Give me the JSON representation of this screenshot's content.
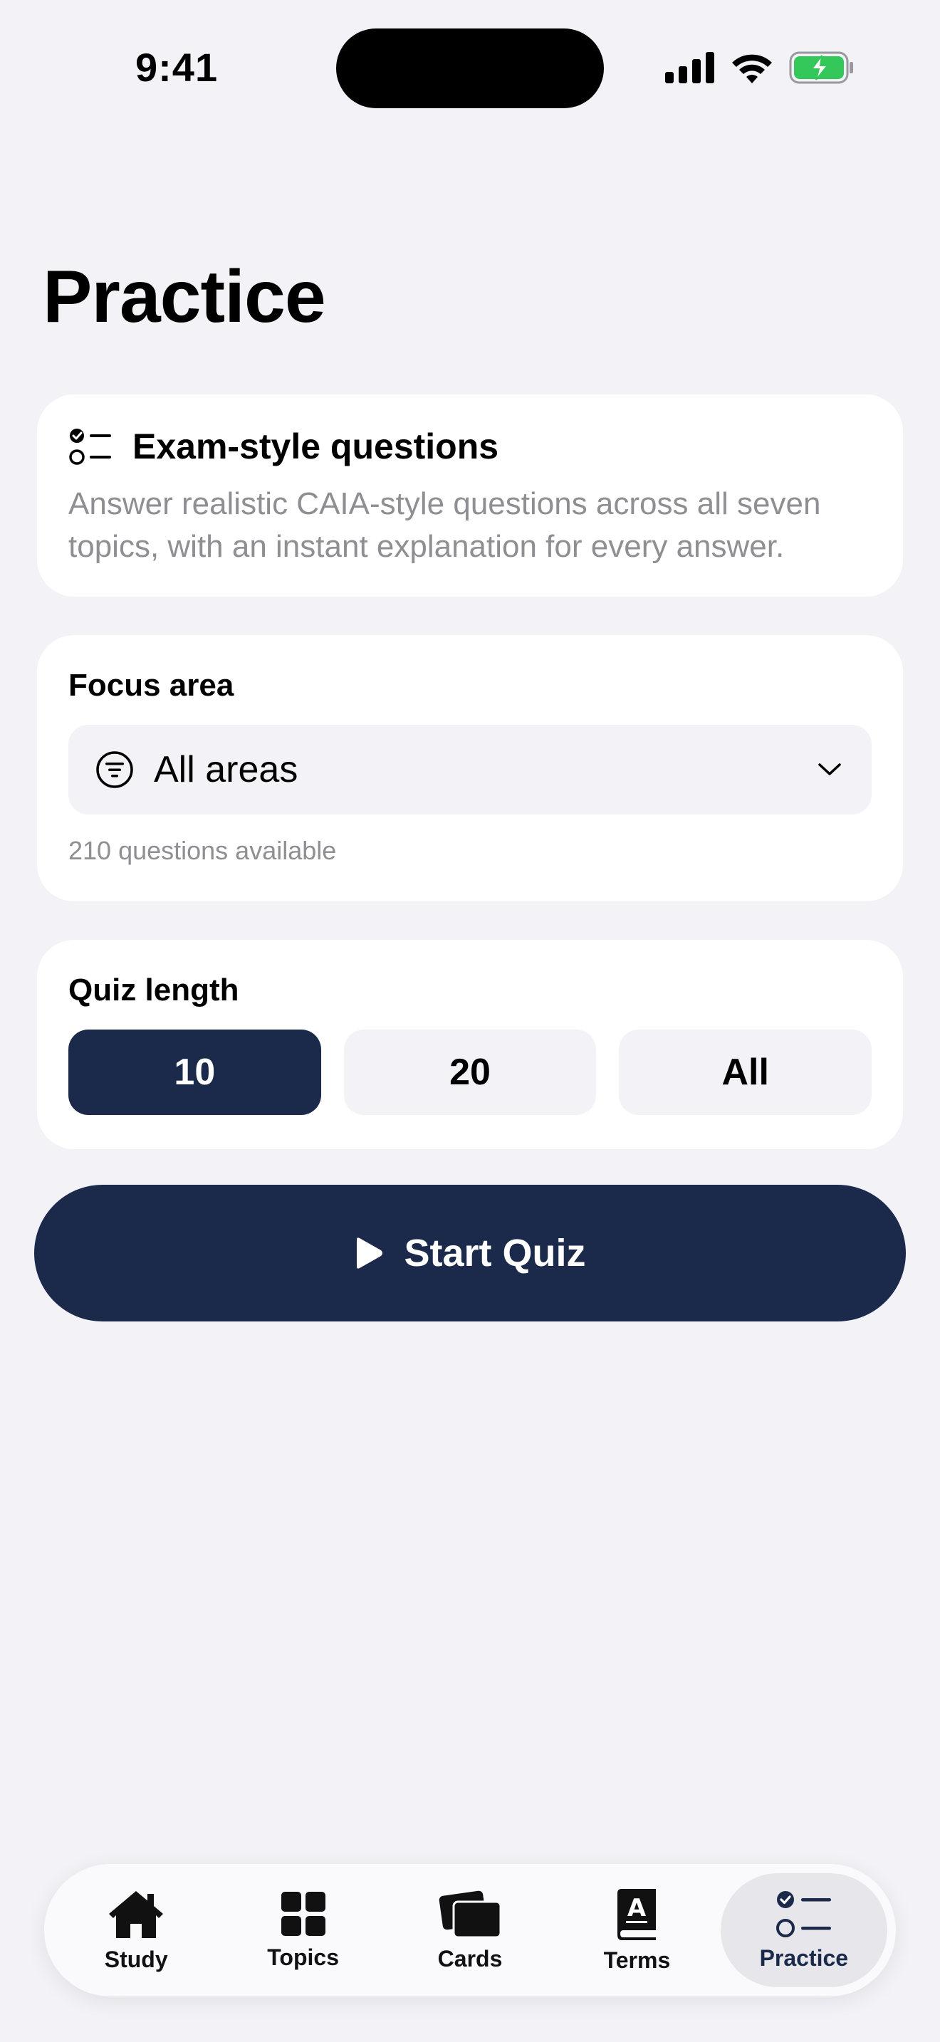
{
  "status_bar": {
    "time": "9:41"
  },
  "page": {
    "title": "Practice"
  },
  "intro_card": {
    "icon": "checklist-icon",
    "title": "Exam-style questions",
    "description": "Answer realistic CAIA-style questions across all seven topics, with an instant explanation for every answer."
  },
  "focus_area": {
    "label": "Focus area",
    "selected": "All areas",
    "icon": "filter-icon",
    "helper": "210 questions available"
  },
  "quiz_length": {
    "label": "Quiz length",
    "options": [
      "10",
      "20",
      "All"
    ],
    "selected": "10"
  },
  "start_button": {
    "label": "Start Quiz",
    "icon": "play-icon"
  },
  "tab_bar": {
    "items": [
      {
        "label": "Study",
        "icon": "house-icon"
      },
      {
        "label": "Topics",
        "icon": "grid-icon"
      },
      {
        "label": "Cards",
        "icon": "cards-icon"
      },
      {
        "label": "Terms",
        "icon": "dictionary-icon"
      },
      {
        "label": "Practice",
        "icon": "checklist-icon"
      }
    ],
    "active": "Practice"
  },
  "colors": {
    "background": "#F2F2F7",
    "accent": "#1B2A4A",
    "card": "#FFFFFF",
    "secondary_text": "#8E8E93",
    "battery": "#34C759"
  }
}
